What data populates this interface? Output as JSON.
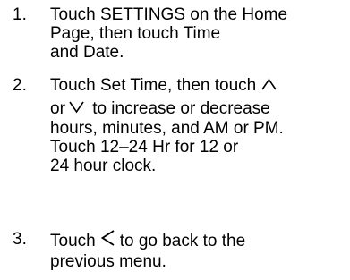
{
  "steps": [
    {
      "number": "1.",
      "lines": [
        "Touch SETTINGS on the Home",
        "Page, then touch Time",
        "and Date."
      ]
    },
    {
      "number": "2.",
      "line1_text": "Touch Set Time, then touch",
      "line2_before": "or",
      "line2_after": "to increase or decrease",
      "lines_rest": [
        "hours, minutes, and AM or PM.",
        "Touch 12–24 Hr for 12 or",
        "24 hour clock."
      ],
      "icons": [
        "chevron-up-icon",
        "chevron-down-icon"
      ]
    },
    {
      "number": "3.",
      "line1_before": "Touch",
      "line1_after": "to go back to the",
      "lines_rest": [
        "previous menu."
      ],
      "icons": [
        "chevron-left-icon"
      ]
    }
  ]
}
